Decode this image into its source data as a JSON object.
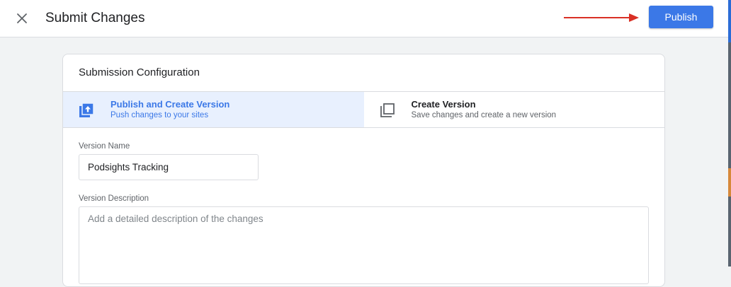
{
  "header": {
    "title": "Submit Changes",
    "publish_label": "Publish",
    "close_icon": "close-icon",
    "accent": "#3b78e7",
    "annotation_color": "#d93025"
  },
  "card": {
    "title": "Submission Configuration",
    "options": [
      {
        "title": "Publish and Create Version",
        "subtitle": "Push changes to your sites",
        "icon": "publish-upload-icon",
        "selected": true
      },
      {
        "title": "Create Version",
        "subtitle": "Save changes and create a new version",
        "icon": "copy-version-icon",
        "selected": false
      }
    ],
    "version_name": {
      "label": "Version Name",
      "value": "Podsights Tracking"
    },
    "version_description": {
      "label": "Version Description",
      "placeholder": "Add a detailed description of the changes"
    }
  }
}
